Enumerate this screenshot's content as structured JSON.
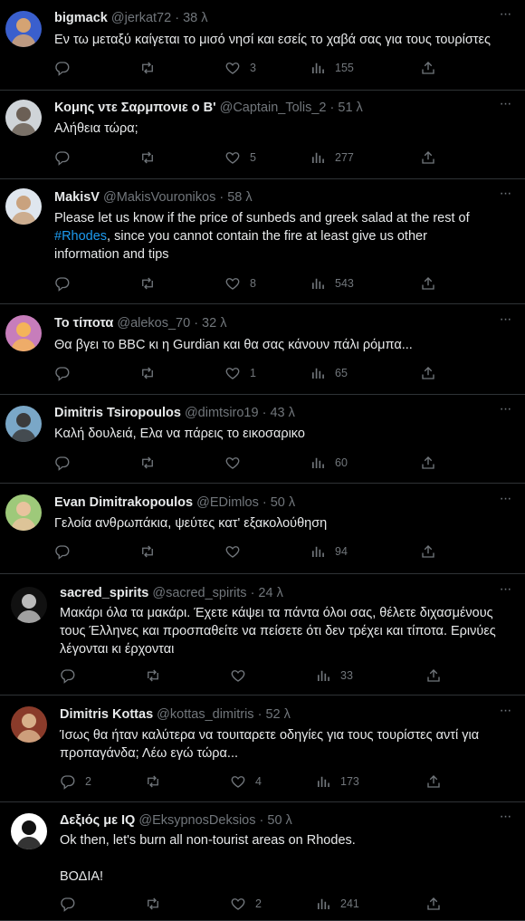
{
  "tweets": [
    {
      "display_name": "bigmack",
      "handle": "@jerkat72",
      "time": "· 38 λ",
      "text": "Εν τω μεταξύ καίγεται το μισό νησί και εσείς το χαβά σας για τους τουρίστες",
      "replies": "",
      "retweets": "",
      "likes": "3",
      "views": "155",
      "avatar": {
        "bg": "#3a5fcd",
        "fg": "#d4a373",
        "label": "avatar-bigmack"
      }
    },
    {
      "display_name": "Κομης ντε Σαρμπονιε ο Β'",
      "handle": "@Captain_Tolis_2",
      "time": "· 51 λ",
      "text": "Αλήθεια τώρα;",
      "replies": "",
      "retweets": "",
      "likes": "5",
      "views": "277",
      "avatar": {
        "bg": "#cfd4d8",
        "fg": "#6b5f55",
        "label": "avatar-captain-tolis"
      }
    },
    {
      "display_name": "MakisV",
      "handle": "@MakisVouronikos",
      "time": "· 58 λ",
      "text_before": "Please let us know if the price of sunbeds and greek salad at the rest of\n",
      "hashtag": "#Rhodes",
      "text_after": ", since you cannot contain the fire at least give us other\ninformation and tips",
      "replies": "",
      "retweets": "",
      "likes": "8",
      "views": "543",
      "avatar": {
        "bg": "#dfe6ee",
        "fg": "#c9a27e",
        "label": "avatar-makisv"
      }
    },
    {
      "display_name": "Το τίποτα",
      "handle": "@alekos_70",
      "time": "· 32 λ",
      "text": "Θα βγει το BBC κι η Gurdian και θα σας κάνουν πάλι ρόμπα...",
      "replies": "",
      "retweets": "",
      "likes": "1",
      "views": "65",
      "avatar": {
        "bg": "#c77dbb",
        "fg": "#f4b45a",
        "label": "avatar-alekos"
      }
    },
    {
      "display_name": "Dimitris Tsiropoulos",
      "handle": "@dimtsiro19",
      "time": "· 43 λ",
      "text": "Καλή δουλειά, Ελα να πάρεις το εικοσαρικο",
      "replies": "",
      "retweets": "",
      "likes": "",
      "views": "60",
      "avatar": {
        "bg": "#7aa7c7",
        "fg": "#3b3b3b",
        "label": "avatar-tsiropoulos"
      }
    },
    {
      "display_name": "Evan Dimitrakopoulos",
      "handle": "@EDimlos",
      "time": "· 50 λ",
      "text": "Γελοία ανθρωπάκια, ψεύτες κατ' εξακολούθηση",
      "replies": "",
      "retweets": "",
      "likes": "",
      "views": "94",
      "avatar": {
        "bg": "#9ec97a",
        "fg": "#e8c39e",
        "label": "avatar-edimlos"
      }
    },
    {
      "display_name": "sacred_spirits",
      "handle": "@sacred_spirits",
      "time": "· 24 λ",
      "text": "Μακάρι όλα τα μακάρι. Έχετε κάψει τα πάντα όλοι σας, θέλετε διχασμένους\nτους Έλληνες και προσπαθείτε να πείσετε ότι δεν τρέχει και τίποτα. Ερινύες\nλέγονται κι έρχονται",
      "replies": "",
      "retweets": "",
      "likes": "",
      "views": "33",
      "avatar": {
        "bg": "#111111",
        "fg": "#bbbbbb",
        "label": "avatar-sacred-spirits"
      }
    },
    {
      "display_name": "Dimitris Kottas",
      "handle": "@kottas_dimitris",
      "time": "· 52 λ",
      "text": "Ίσως θα ήταν καλύτερα να τουιταρετε οδηγίες για τους τουρίστες αντί για\nπροπαγάνδα; Λέω εγώ τώρα...",
      "replies": "2",
      "retweets": "",
      "likes": "4",
      "views": "173",
      "avatar": {
        "bg": "#8a3b2a",
        "fg": "#d8b08a",
        "label": "avatar-kottas"
      }
    },
    {
      "display_name": "Δεξιός με IQ",
      "handle": "@EksypnosDeksios",
      "time": "· 50 λ",
      "text": "Ok then, let's burn all non-tourist areas on Rhodes.\n\nΒΟΔΙΑ!",
      "replies": "",
      "retweets": "",
      "likes": "2",
      "views": "241",
      "avatar": {
        "bg": "#ffffff",
        "fg": "#111111",
        "label": "avatar-deksios"
      }
    }
  ],
  "more_glyph": "···",
  "colors": {
    "background": "#000000",
    "text": "#e7e9ea",
    "muted": "#71767b",
    "link": "#1d9bf0",
    "divider": "#2f3336"
  },
  "icons": [
    "reply-icon",
    "retweet-icon",
    "like-icon",
    "views-icon",
    "share-icon",
    "more-icon"
  ]
}
